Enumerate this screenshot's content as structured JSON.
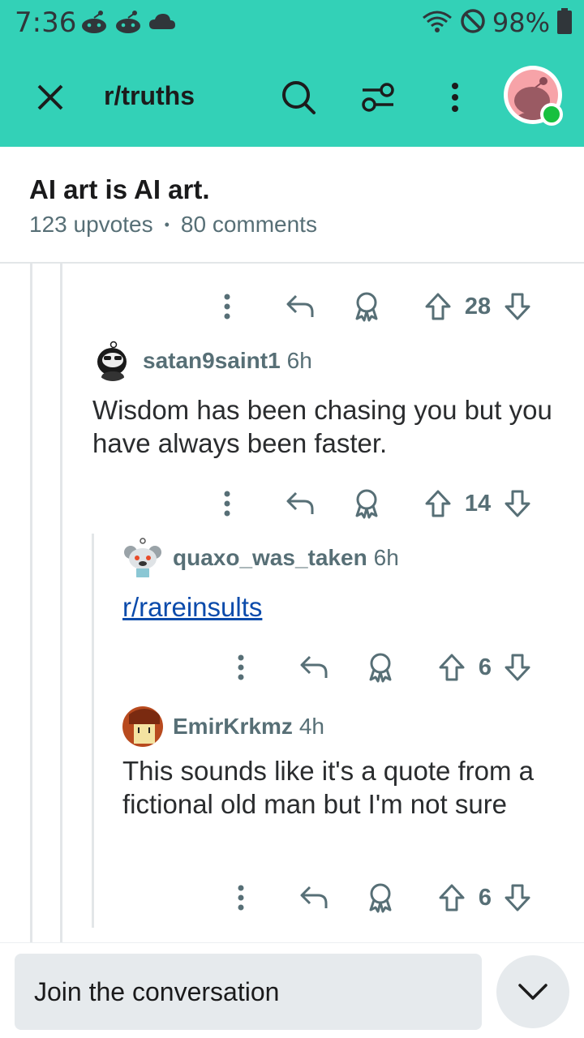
{
  "status_bar": {
    "time": "7:36",
    "battery_percent": "98%",
    "icons": [
      "reddit-notification-icon",
      "reddit-notification-icon",
      "cloud-icon",
      "wifi-icon",
      "do-not-disturb-icon",
      "battery-icon"
    ]
  },
  "app_bar": {
    "subreddit": "r/truths",
    "icons": [
      "close-icon",
      "search-icon",
      "filter-icon",
      "more-vertical-icon",
      "user-avatar"
    ]
  },
  "post": {
    "title": "AI art is AI art.",
    "upvotes": "123 upvotes",
    "separator": "•",
    "comments": "80 comments"
  },
  "actions": [
    {
      "score": "28"
    },
    {
      "score": "14"
    },
    {
      "score": "6"
    },
    {
      "score": "6"
    }
  ],
  "comments": [
    {
      "user": "satan9saint1",
      "time": "6h",
      "body": "Wisdom has been chasing you but you have always been faster."
    },
    {
      "user": "quaxo_was_taken",
      "time": "6h",
      "body": "r/rareinsults"
    },
    {
      "user": "EmirKrkmz",
      "time": "4h",
      "body": "This sounds like it's a quote from a fictional old man but I'm not sure"
    }
  ],
  "composer": {
    "placeholder": "Join the conversation"
  },
  "colors": {
    "accent": "#33d1b7",
    "meta_text": "#576f76",
    "link": "#0b4bab",
    "online": "#18c03f"
  }
}
